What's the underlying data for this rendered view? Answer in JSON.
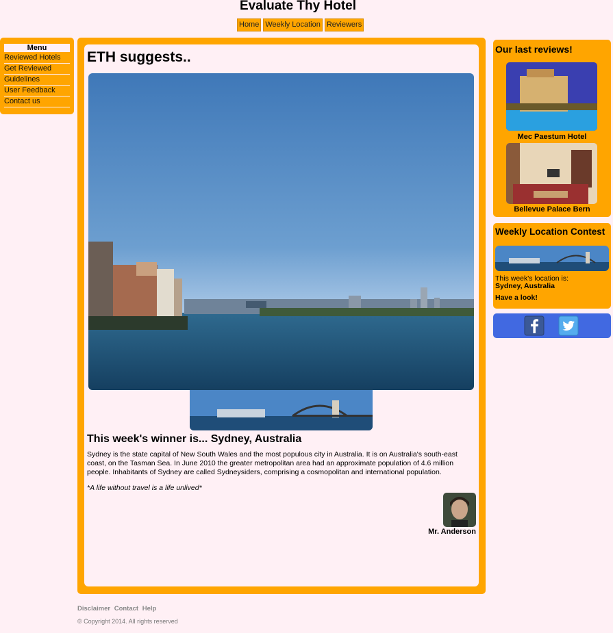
{
  "site": {
    "title": "Evaluate Thy Hotel"
  },
  "topnav": {
    "items": [
      "Home",
      "Weekly Location",
      "Reviewers"
    ]
  },
  "leftmenu": {
    "heading": "Menu",
    "items": [
      "Reviewed Hotels",
      "Get Reviewed",
      "Guidelines",
      "User Feedback",
      "Contact us"
    ]
  },
  "main": {
    "heading": "ETH suggests..",
    "winner_heading": "This week's winner is... Sydney, Australia",
    "winner_text": "Sydney is the state capital of New South Wales and the most populous city in Australia. It is on Australia's south-east coast, on the Tasman Sea. In June 2010 the greater metropolitan area had an approximate population of 4.6 million people. Inhabitants of Sydney are called Sydneysiders, comprising a cosmopolitan and international population.",
    "quote": "*A life without travel is a life unlived*",
    "author": "Mr. Anderson"
  },
  "reviews": {
    "heading": "Our last reviews!",
    "items": [
      {
        "name": "Mec Paestum Hotel"
      },
      {
        "name": "Bellevue Palace Bern"
      }
    ]
  },
  "contest": {
    "heading": "Weekly Location Contest",
    "location_label": "This week's location is:",
    "location": "Sydney, Australia",
    "cta": "Have a look!"
  },
  "social": {
    "icons": [
      "facebook-icon",
      "twitter-icon"
    ]
  },
  "footer": {
    "links": [
      "Disclaimer",
      "Contact",
      "Help"
    ],
    "copyright": "© Copyright 2014. All rights reserved"
  },
  "colors": {
    "accent": "#ffa500",
    "background": "#fff0f5",
    "social": "#4169e1"
  }
}
